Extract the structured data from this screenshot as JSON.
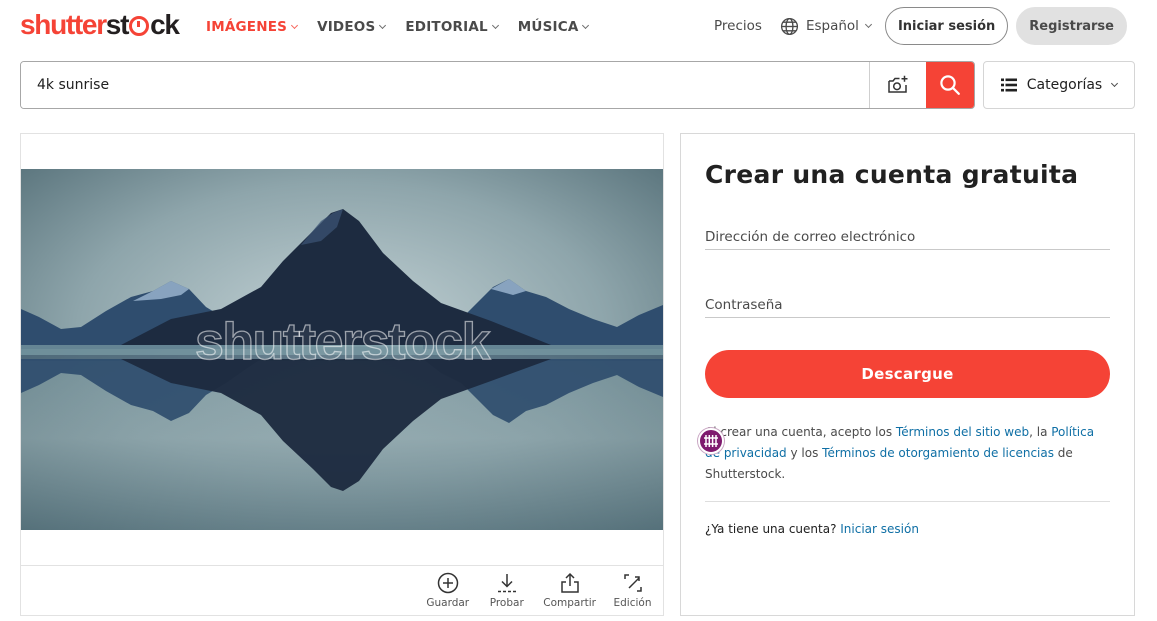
{
  "brand": {
    "logo_part1": "shutter",
    "logo_part2": "st",
    "logo_part3": "ck",
    "accent_color": "#f54336"
  },
  "nav": {
    "items": [
      {
        "label": "IMÁGENES",
        "active": true
      },
      {
        "label": "VIDEOS",
        "active": false
      },
      {
        "label": "EDITORIAL",
        "active": false
      },
      {
        "label": "MÚSICA",
        "active": false
      }
    ],
    "pricing": "Precios",
    "language": "Español",
    "login": "Iniciar sesión",
    "register": "Registrarse"
  },
  "search": {
    "value": "4k sunrise",
    "camera_icon": "camera-plus-icon",
    "search_icon": "search-icon"
  },
  "categories": {
    "label": "Categorías",
    "icon": "list-icon"
  },
  "image": {
    "watermark": "shutterstock",
    "actions": [
      {
        "label": "Guardar",
        "icon": "add-circle-icon"
      },
      {
        "label": "Probar",
        "icon": "download-icon"
      },
      {
        "label": "Compartir",
        "icon": "share-icon"
      },
      {
        "label": "Edición",
        "icon": "edit-icon"
      }
    ]
  },
  "signup": {
    "title": "Crear una cuenta gratuita",
    "email_placeholder": "Dirección de correo electrónico",
    "password_placeholder": "Contraseña",
    "submit": "Descargue",
    "terms": {
      "prefix": "Al crear una cuenta, acepto los ",
      "link1": "Términos del sitio web",
      "mid1": ", la ",
      "link2": "Política de privacidad",
      "mid2": " y los ",
      "link3": "Términos de otorgamiento de licencias",
      "suffix": " de Shutterstock."
    },
    "have_account": "¿Ya tiene una cuenta?",
    "login_link": "Iniciar sesión"
  },
  "overlay_badge": {
    "icon": "extension-grid-icon",
    "color": "#7e1a6e"
  }
}
